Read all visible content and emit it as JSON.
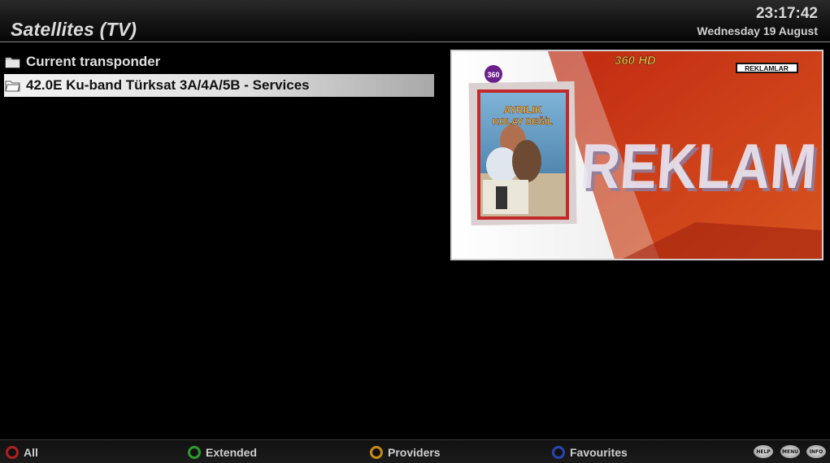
{
  "header": {
    "title": "Satellites (TV)",
    "time": "23:17:42",
    "date": "Wednesday 19 August"
  },
  "list": {
    "items": [
      {
        "label": "Current transponder",
        "icon": "folder-icon",
        "selected": false
      },
      {
        "label": "42.0E Ku-band Türksat 3A/4A/5B - Services",
        "icon": "folder-icon",
        "selected": true
      }
    ]
  },
  "preview": {
    "channel_logo": "360",
    "channel_name": "360 HD",
    "badge": "REKLAMLAR",
    "big_text": "REKLAM",
    "poster_title_line1": "AYRILIK",
    "poster_title_line2": "KOLAY DEĞİL"
  },
  "footer": {
    "buttons": [
      {
        "label": "All",
        "color": "#b02020"
      },
      {
        "label": "Extended",
        "color": "#2f9a2f"
      },
      {
        "label": "Providers",
        "color": "#c88a18"
      },
      {
        "label": "Favourites",
        "color": "#2a44b0"
      }
    ],
    "keys": [
      "HELP",
      "MENU",
      "INFO"
    ]
  },
  "colors": {
    "accent_red": "#c8361a",
    "selection": "#e6e6e6"
  }
}
